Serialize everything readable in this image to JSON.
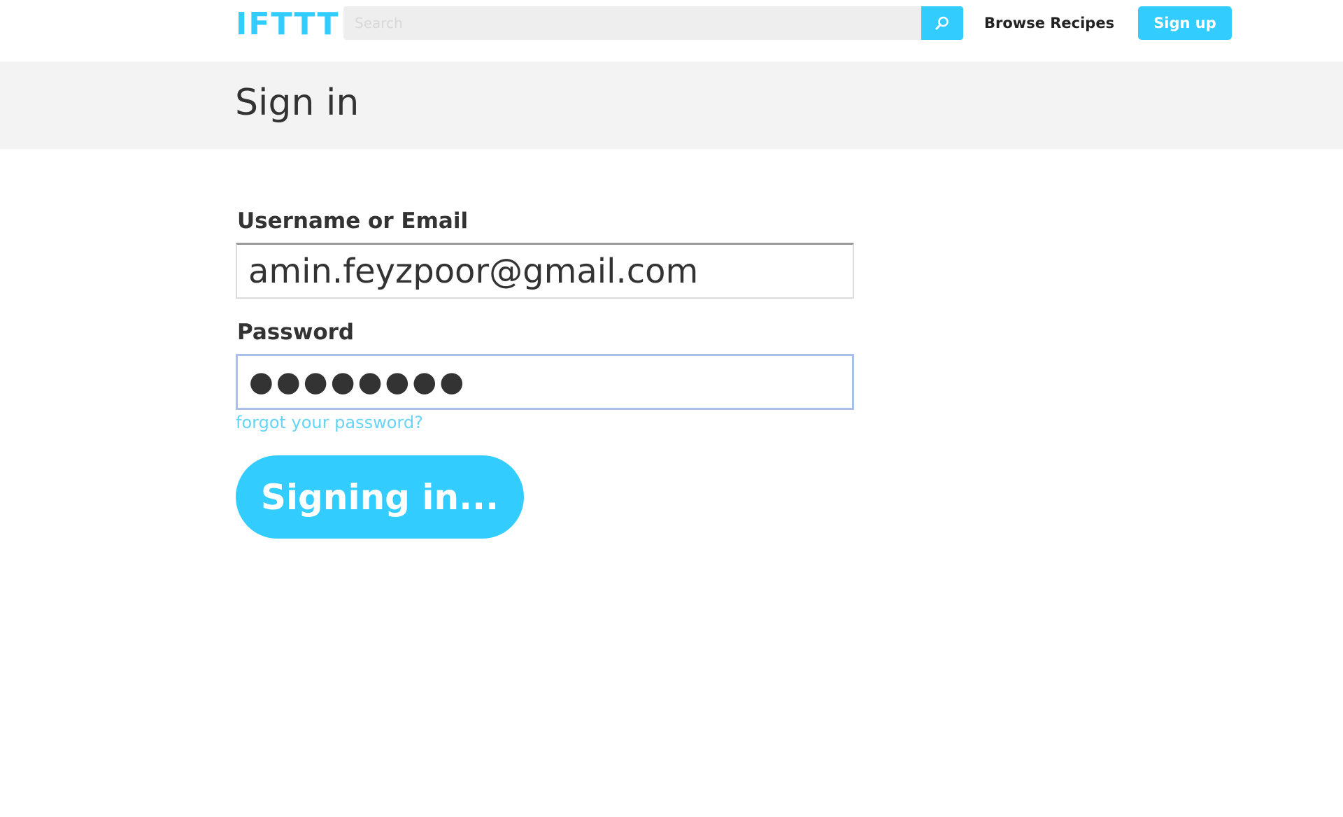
{
  "header": {
    "logo_text": "IFTTT",
    "search": {
      "placeholder": "Search",
      "value": ""
    },
    "search_icon": "search-icon",
    "browse_label": "Browse Recipes",
    "signup_label": "Sign up"
  },
  "page": {
    "title": "Sign in"
  },
  "form": {
    "username_label": "Username or Email",
    "username_value": "amin.feyzpoor@gmail.com",
    "password_label": "Password",
    "password_value": "●●●●●●●●",
    "forgot_label": "forgot your password?",
    "submit_label": "Signing in..."
  },
  "colors": {
    "accent": "#33ccff",
    "band": "#f3f3f3",
    "text": "#333333",
    "link": "#66d4f5",
    "focus_border": "#a8c0ea"
  }
}
